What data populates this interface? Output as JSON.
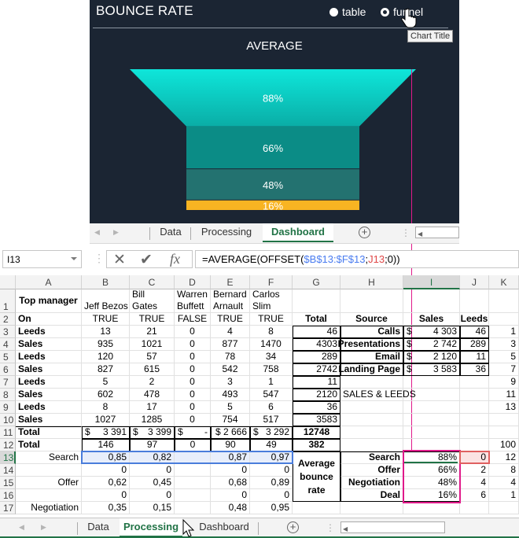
{
  "dashboard": {
    "title": "BOUNCE RATE",
    "radio_options": [
      {
        "label": "table",
        "selected": true
      },
      {
        "label": "funnel",
        "selected": false
      }
    ],
    "tooltip": "Chart Title",
    "sheet_tabs": [
      "Data",
      "Processing",
      "Dashboard"
    ],
    "active_tab": "Dashboard"
  },
  "chart_data": {
    "type": "funnel",
    "title": "AVERAGE",
    "categories": [
      "Search",
      "Offer",
      "Negotiation",
      "Deal"
    ],
    "values": [
      88,
      66,
      48,
      16
    ],
    "labels": [
      "88%",
      "66%",
      "48%",
      "16%"
    ],
    "colors": [
      "#0ee3d8",
      "#0b8c86",
      "#237270",
      "#f8b422"
    ],
    "background": "#1b2533"
  },
  "formula_bar": {
    "name_box": "I13",
    "formula_prefix": "=AVERAGE(OFFSET(",
    "formula_ref1": "$B$13:$F$13",
    "formula_sep": ";",
    "formula_ref2": "J13",
    "formula_suffix": ";0))"
  },
  "grid": {
    "columns": [
      "A",
      "B",
      "C",
      "D",
      "E",
      "F",
      "G",
      "H",
      "I",
      "J",
      "K"
    ],
    "selected_column": "I",
    "rows": [
      "1",
      "2",
      "3",
      "4",
      "5",
      "6",
      "7",
      "8",
      "9",
      "10",
      "11",
      "12",
      "13",
      "14",
      "15",
      "16",
      "17"
    ],
    "selected_row": "13",
    "header": {
      "a1": "Top manager",
      "managers": [
        {
          "line1": "",
          "line2": "Jeff Bezos"
        },
        {
          "line1": "Bill",
          "line2": "Gates"
        },
        {
          "line1": "Warren",
          "line2": "Buffett"
        },
        {
          "line1": "Bernard",
          "line2": "Arnault"
        },
        {
          "line1": "Carlos",
          "line2": "Slim"
        }
      ]
    },
    "row2": {
      "label": "On",
      "values": [
        "TRUE",
        "TRUE",
        "FALSE",
        "TRUE",
        "TRUE"
      ],
      "g": "Total",
      "h": "Source",
      "i": "Sales",
      "j": "Leeds"
    },
    "data_rows": [
      {
        "label": "Leeds",
        "values": [
          "13",
          "21",
          "0",
          "4",
          "8"
        ],
        "g": "46",
        "h": "Calls",
        "i_cur": "$",
        "i": "4 303",
        "j": "46",
        "k": "1"
      },
      {
        "label": "Sales",
        "values": [
          "935",
          "1021",
          "0",
          "877",
          "1470"
        ],
        "g": "4303",
        "h": "Presentations",
        "i_cur": "$",
        "i": "2 742",
        "j": "289",
        "k": "3"
      },
      {
        "label": "Leeds",
        "values": [
          "120",
          "57",
          "0",
          "78",
          "34"
        ],
        "g": "289",
        "h": "Email",
        "i_cur": "$",
        "i": "2 120",
        "j": "11",
        "k": "5"
      },
      {
        "label": "Sales",
        "values": [
          "827",
          "615",
          "0",
          "542",
          "758"
        ],
        "g": "2742",
        "h": "Landing Page",
        "i_cur": "$",
        "i": "3 583",
        "j": "36",
        "k": "7"
      },
      {
        "label": "Leeds",
        "values": [
          "5",
          "2",
          "0",
          "3",
          "1"
        ],
        "g": "11",
        "h": "",
        "i_cur": "",
        "i": "",
        "j": "",
        "k": "9"
      },
      {
        "label": "Sales",
        "values": [
          "602",
          "478",
          "0",
          "493",
          "547"
        ],
        "g": "2120",
        "h": "SALES & LEEDS",
        "i_cur": "",
        "i": "",
        "j": "",
        "k": "11"
      },
      {
        "label": "Leeds",
        "values": [
          "8",
          "17",
          "0",
          "5",
          "6"
        ],
        "g": "36",
        "h": "",
        "i_cur": "",
        "i": "",
        "j": "",
        "k": "13"
      },
      {
        "label": "Sales",
        "values": [
          "1027",
          "1285",
          "0",
          "754",
          "517"
        ],
        "g": "3583",
        "h": "",
        "i_cur": "",
        "i": "",
        "j": "",
        "k": ""
      }
    ],
    "row11": {
      "label": "Total",
      "values": [
        {
          "cur": "$",
          "v": "3 391"
        },
        {
          "cur": "$",
          "v": "3 399"
        },
        {
          "cur": "$",
          "v": "-"
        },
        {
          "cur": "",
          "v": "$ 2 666"
        },
        {
          "cur": "$",
          "v": "3 292"
        }
      ],
      "g": "12748"
    },
    "row12": {
      "label": "Total",
      "values": [
        "146",
        "97",
        "0",
        "90",
        "49"
      ],
      "g": "382",
      "k": "100"
    },
    "stage_rows": [
      {
        "label": "Search",
        "values": [
          "0,85",
          "0,82",
          "",
          "0,87",
          "0,97"
        ],
        "h": "Search",
        "i": "88%",
        "j": "0",
        "k": "12"
      },
      {
        "label": "",
        "values": [
          "0",
          "0",
          "",
          "0",
          "0"
        ],
        "h": "Offer",
        "i": "66%",
        "j": "2",
        "k": "8"
      },
      {
        "label": "Offer",
        "values": [
          "0,62",
          "0,45",
          "",
          "0,68",
          "0,89"
        ],
        "h": "Negotiation",
        "i": "48%",
        "j": "4",
        "k": "4"
      },
      {
        "label": "",
        "values": [
          "0",
          "0",
          "",
          "0",
          "0"
        ],
        "h": "Deal",
        "i": "16%",
        "j": "6",
        "k": "1"
      },
      {
        "label": "Negotiation",
        "values": [
          "0,35",
          "0,15",
          "",
          "0,48",
          "0,95"
        ],
        "h": "",
        "i": "",
        "j": "",
        "k": ""
      }
    ],
    "avg_label_line1": "Average",
    "avg_label_line2": "bounce",
    "avg_label_line3": "rate"
  },
  "bottom_tabs": {
    "tabs": [
      "Data",
      "Processing",
      "Dashboard"
    ],
    "active_tab": "Processing"
  }
}
